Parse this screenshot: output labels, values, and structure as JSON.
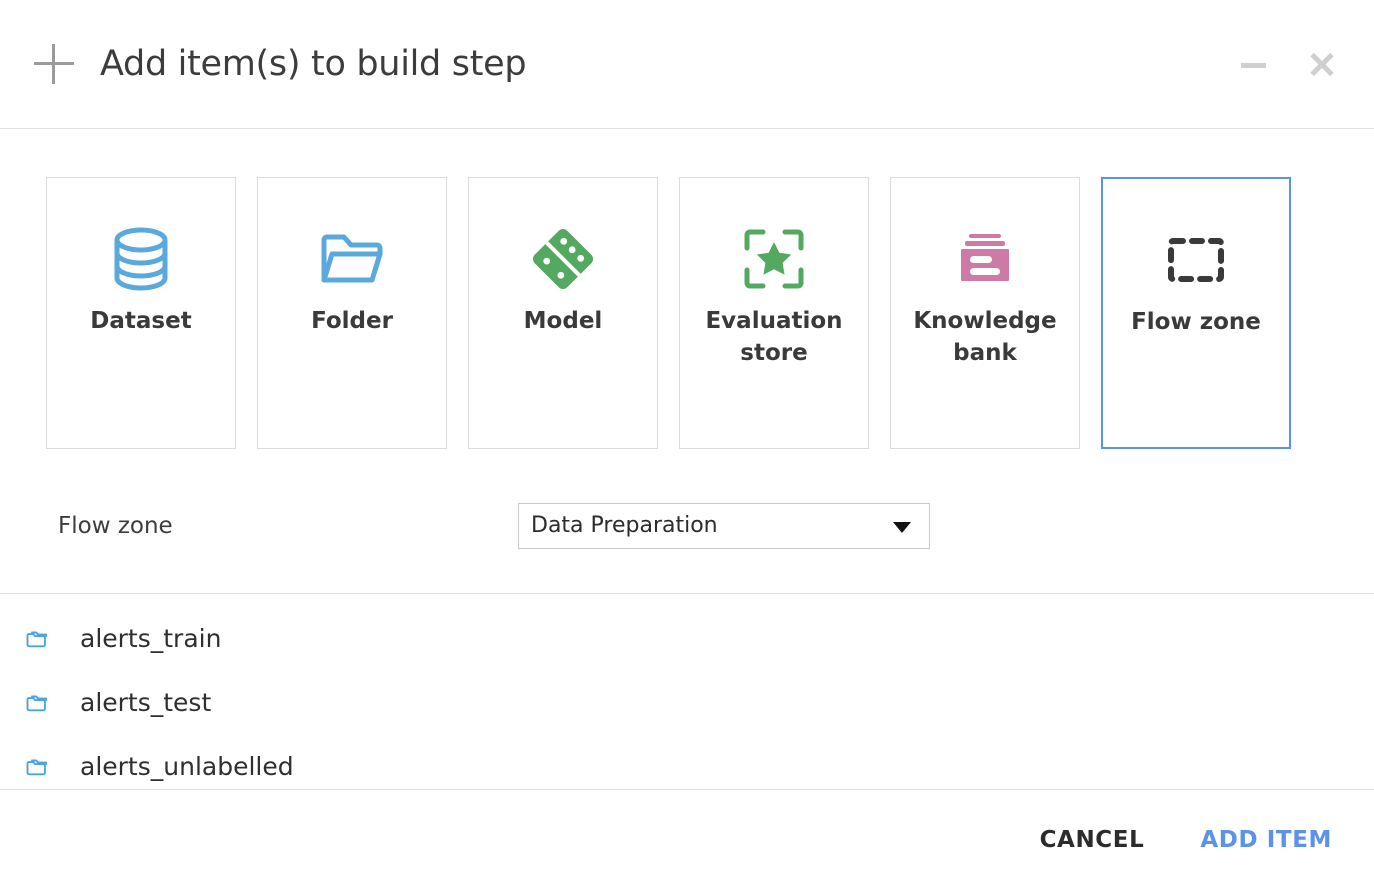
{
  "header": {
    "title": "Add item(s) to build step",
    "plus_icon": "plus-icon",
    "minimize_label": "–",
    "close_label": "×"
  },
  "tiles": [
    {
      "label": "Dataset",
      "icon": "database-icon",
      "color": "#5aa9dd",
      "selected": false
    },
    {
      "label": "Folder",
      "icon": "folder-icon",
      "color": "#5aa9dd",
      "selected": false
    },
    {
      "label": "Model",
      "icon": "domino-icon",
      "color": "#52a95f",
      "selected": false
    },
    {
      "label": "Evaluation store",
      "icon": "star-bracket-icon",
      "color": "#52a95f",
      "selected": false
    },
    {
      "label": "Knowledge bank",
      "icon": "knowledge-bank-icon",
      "color": "#cd7ba6",
      "selected": false
    },
    {
      "label": "Flow zone",
      "icon": "dashed-zone-icon",
      "color": "#3a3a3a",
      "selected": true
    }
  ],
  "form": {
    "flow_zone_label": "Flow zone",
    "flow_zone_value": "Data Preparation",
    "flow_zone_options": [
      "Data Preparation"
    ],
    "dropdown_icon": "chevron-down-icon"
  },
  "list": {
    "items": [
      {
        "label": "alerts_train",
        "icon": "folder-icon"
      },
      {
        "label": "alerts_test",
        "icon": "folder-icon"
      },
      {
        "label": "alerts_unlabelled",
        "icon": "folder-icon"
      }
    ]
  },
  "footer": {
    "cancel_label": "CANCEL",
    "add_label": "ADD ITEM"
  },
  "colors": {
    "accent_blue": "#5b92ea",
    "icon_blue": "#5aa9dd",
    "icon_green": "#52a95f",
    "icon_pink": "#cd7ba6",
    "border_gray": "#dcdcdc"
  }
}
